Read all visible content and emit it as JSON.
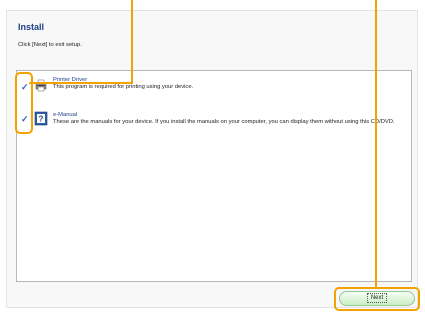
{
  "header": {
    "title": "Install",
    "subtitle": "Click [Next] to exit setup."
  },
  "items": [
    {
      "title": "Printer Driver",
      "description": "This program is required for printing using your device.",
      "checked": true,
      "icon": "printer-icon"
    },
    {
      "title": "e-Manual",
      "description": "These are the manuals for your device. If you install the manuals on your computer, you can display them without using this CD/DVD.",
      "checked": true,
      "icon": "manual-book-icon"
    }
  ],
  "footer": {
    "next_label": "Next"
  },
  "colors": {
    "title": "#1c3f8a",
    "check": "#2f64c5",
    "callout": "#f4a200",
    "button_green": "#c9eec4"
  }
}
